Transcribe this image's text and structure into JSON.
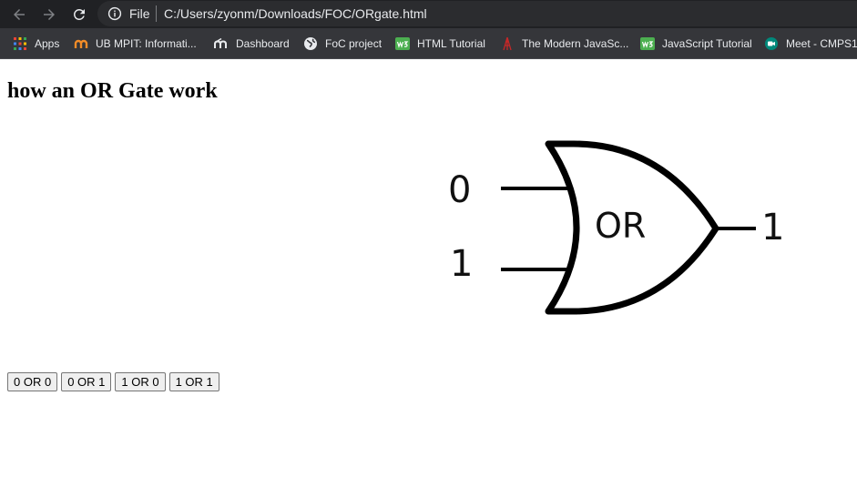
{
  "browser": {
    "file_label": "File",
    "url": "C:/Users/zyonm/Downloads/FOC/ORgate.html",
    "bookmarks": [
      {
        "label": "Apps",
        "icon": "apps-grid-icon"
      },
      {
        "label": "UB MPIT: Informati...",
        "icon": "ub-logo-icon"
      },
      {
        "label": "Dashboard",
        "icon": "moodle-icon"
      },
      {
        "label": "FoC project",
        "icon": "globe-icon"
      },
      {
        "label": "HTML Tutorial",
        "icon": "w3schools-icon"
      },
      {
        "label": "The Modern JavaSc...",
        "icon": "tower-icon"
      },
      {
        "label": "JavaScript Tutorial",
        "icon": "w3schools-icon"
      },
      {
        "label": "Meet - CMPS1",
        "icon": "meet-icon"
      }
    ]
  },
  "page": {
    "title": "how an OR Gate work",
    "gate": {
      "input_a": "0",
      "input_b": "1",
      "gate_label": "OR",
      "output": "1"
    },
    "buttons": [
      "0 OR 0",
      "0 OR 1",
      "1 OR 0",
      "1 OR 1"
    ]
  }
}
